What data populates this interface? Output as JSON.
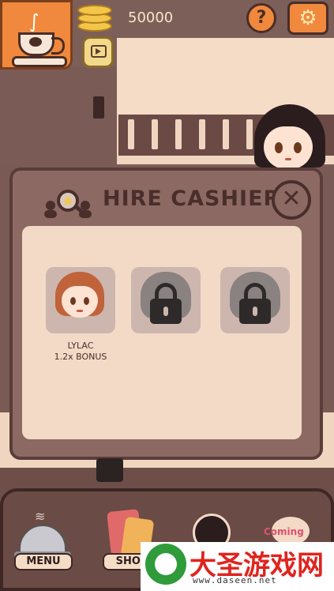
{
  "topbar": {
    "coins": "50000",
    "help_label": "?",
    "settings_icon": "gear-icon"
  },
  "modal": {
    "title": "HIRE CASHIER",
    "close_label": "✕",
    "cashiers": [
      {
        "name": "LYLAC",
        "bonus": "1.2x BONUS",
        "locked": false
      },
      {
        "name": "",
        "bonus": "",
        "locked": true
      },
      {
        "name": "",
        "bonus": "",
        "locked": true
      }
    ]
  },
  "nav": {
    "menu_label": "MENU",
    "shop_label": "SHOP",
    "coming_label": "Coming"
  },
  "watermark": {
    "title": "大圣游戏网",
    "url": "www.daseen.net"
  },
  "colors": {
    "accent_orange": "#f0893d",
    "modal_bg": "#8c6a63",
    "panel_bg": "#f2dac7",
    "text_dark": "#4a2e2b"
  }
}
